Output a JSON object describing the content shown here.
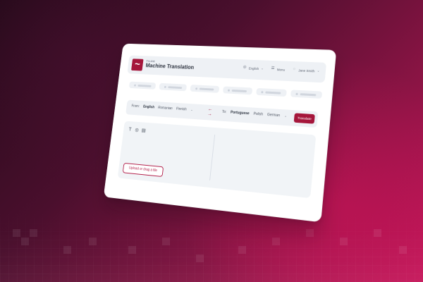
{
  "brand": {
    "eyebrow": "TILDE",
    "title": "Machine Translation"
  },
  "header": {
    "language_label": "English",
    "menu_label": "Menu",
    "user_label": "Jane Smith",
    "icons": {
      "language": "globe-icon",
      "menu": "menu-icon",
      "user": "user-icon",
      "caret": "chevron-down-icon"
    }
  },
  "chips": [
    {
      "index": 1
    },
    {
      "index": 2
    },
    {
      "index": 3
    },
    {
      "index": 4
    },
    {
      "index": 5
    },
    {
      "index": 6
    }
  ],
  "translation_bar": {
    "from_label": "From:",
    "from_languages": [
      "English",
      "Romanian",
      "Finnish"
    ],
    "to_label": "To:",
    "to_languages": [
      "Portuguese",
      "Polish",
      "German"
    ],
    "translate_button": "Translate"
  },
  "editor": {
    "tools": [
      "text-icon",
      "globe-icon",
      "document-icon"
    ],
    "upload_button": "Upload or drag a file"
  },
  "colors": {
    "accent": "#a5163b",
    "panel_bg": "#eef1f5",
    "editor_bg": "#f1f4f7"
  }
}
